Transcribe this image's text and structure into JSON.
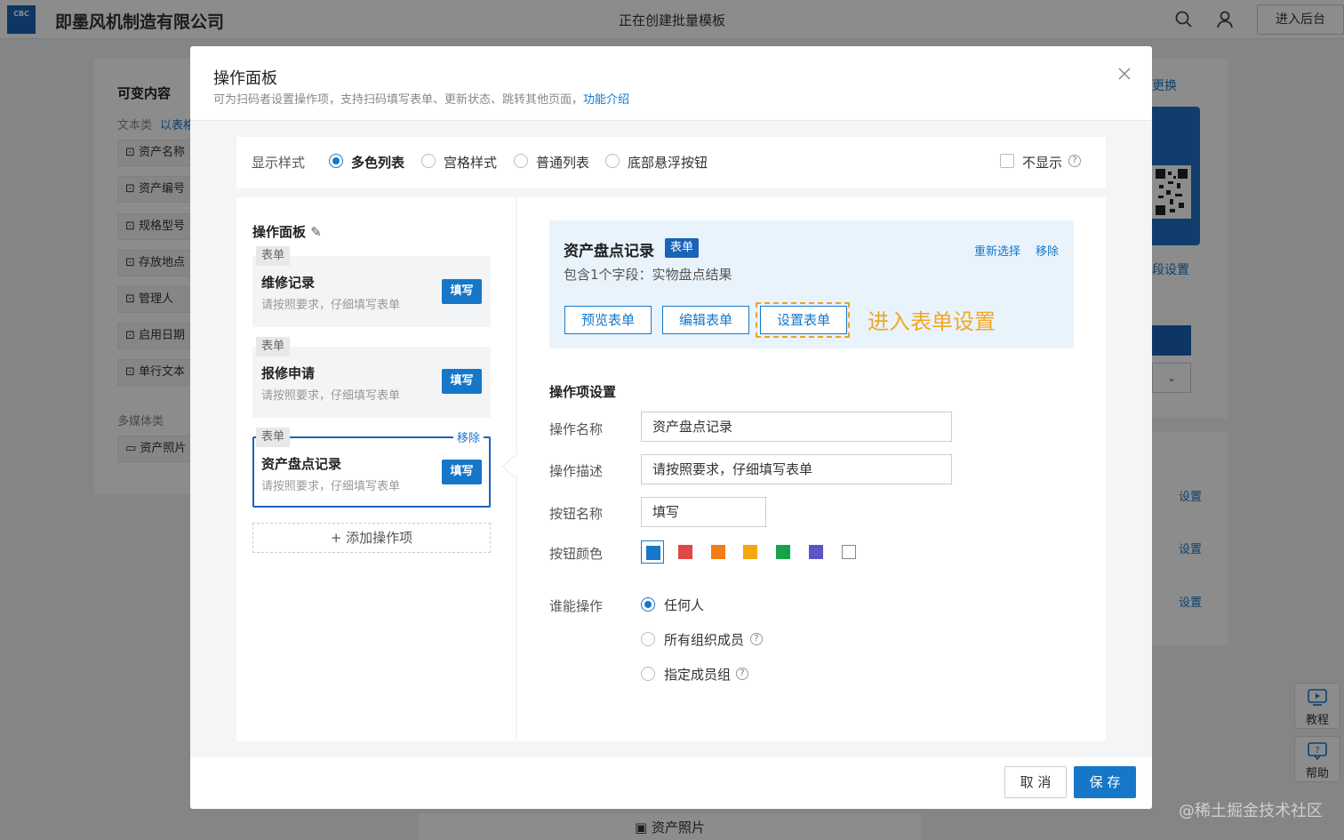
{
  "background": {
    "company": "即墨风机制造有限公司",
    "logo_text": "CBC",
    "creating_title": "正在创建批量模板",
    "enter_admin": "进入后台",
    "left_panel": {
      "title": "可变内容",
      "text_category": "文本类",
      "text_link": "以表格",
      "items": [
        "资产名称",
        "资产编号",
        "规格型号",
        "存放地点",
        "管理人",
        "启用日期",
        "单行文本"
      ],
      "media_category": "多媒体类",
      "media_items": [
        "资产照片"
      ]
    },
    "right_panel": {
      "replace_link": "更换",
      "field_settings": "段设置",
      "settings_links": [
        "设置",
        "设置",
        "设置"
      ]
    },
    "side_buttons": {
      "tutorial": "教程",
      "help": "帮助"
    },
    "bottom_photo": "资产照片",
    "watermark": "@稀土掘金技术社区"
  },
  "modal": {
    "title": "操作面板",
    "subtitle": "可为扫码者设置操作项，支持扫码填写表单、更新状态、跳转其他页面，",
    "subtitle_link": "功能介绍",
    "display_style_label": "显示样式",
    "display_styles": [
      "多色列表",
      "宫格样式",
      "普通列表",
      "底部悬浮按钮"
    ],
    "selected_style": "多色列表",
    "hide_label": "不显示",
    "panel_title": "操作面板",
    "cards": [
      {
        "tag": "表单",
        "name": "维修记录",
        "desc": "请按照要求，仔细填写表单",
        "button": "填写"
      },
      {
        "tag": "表单",
        "name": "报修申请",
        "desc": "请按照要求，仔细填写表单",
        "button": "填写"
      },
      {
        "tag": "表单",
        "name": "资产盘点记录",
        "desc": "请按照要求，仔细填写表单",
        "button": "填写",
        "remove": "移除"
      }
    ],
    "add_item": "+ 添加操作项",
    "form_card": {
      "name": "资产盘点记录",
      "tag": "表单",
      "reselect": "重新选择",
      "remove": "移除",
      "fields": "包含1个字段：实物盘点结果",
      "buttons": [
        "预览表单",
        "编辑表单",
        "设置表单"
      ],
      "hint": "进入表单设置"
    },
    "section_title": "操作项设置",
    "fields": {
      "name_label": "操作名称",
      "name_value": "资产盘点记录",
      "desc_label": "操作描述",
      "desc_value": "请按照要求，仔细填写表单",
      "button_label": "按钮名称",
      "button_value": "填写",
      "color_label": "按钮颜色"
    },
    "colors": [
      "#1677c8",
      "#e04848",
      "#f07d16",
      "#f5a60a",
      "#16a34a",
      "#5b55c8",
      "#ffffff"
    ],
    "selected_color": "#1677c8",
    "permission_label": "谁能操作",
    "permissions": [
      "任何人",
      "所有组织成员",
      "指定成员组"
    ],
    "selected_permission": "任何人",
    "cancel": "取 消",
    "save": "保 存"
  }
}
